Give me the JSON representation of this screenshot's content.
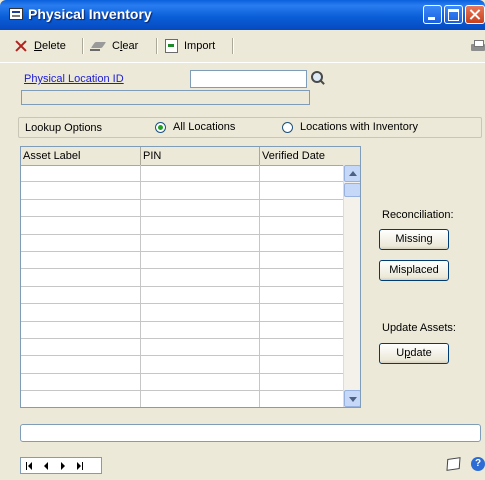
{
  "window": {
    "title": "Physical Inventory"
  },
  "toolbar": {
    "delete_label_pre": "",
    "delete_label_ul": "D",
    "delete_label_post": "elete",
    "clear_label_pre": "C",
    "clear_label_ul": "l",
    "clear_label_post": "ear",
    "import_label": "Import"
  },
  "form": {
    "location_id_label": "Physical Location ID",
    "location_id_value": "",
    "description_value": ""
  },
  "lookup": {
    "label": "Lookup Options",
    "options": [
      {
        "label": "All Locations",
        "selected": true
      },
      {
        "label": "Locations with Inventory",
        "selected": false
      }
    ]
  },
  "grid": {
    "columns": [
      "Asset Label",
      "PIN",
      "Verified Date"
    ],
    "rows": []
  },
  "right_panel": {
    "reconciliation_label": "Reconciliation:",
    "missing_label": "Missing",
    "misplaced_label": "Misplaced",
    "update_assets_label": "Update Assets:",
    "update_label_pre": "U",
    "update_label_ul": "p",
    "update_label_post": "date"
  },
  "help": {
    "icon_glyph": "?"
  },
  "icons": [
    "delete-icon",
    "clear-icon",
    "import-icon",
    "printer-icon",
    "lookup-icon",
    "note-icon",
    "help-icon"
  ]
}
